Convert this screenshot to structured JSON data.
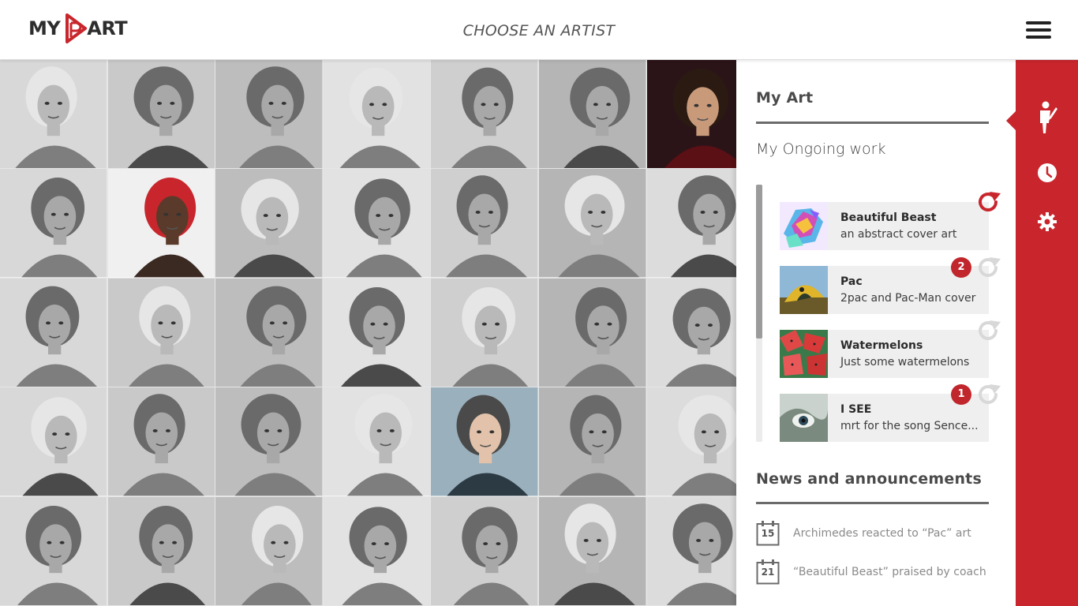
{
  "app": {
    "logo_left": "MY",
    "logo_right": "ART",
    "page_title": "CHOOSE AN ARTIST"
  },
  "artist_grid": {
    "rows": 5,
    "columns": 7,
    "highlighted_tiles": [
      6,
      8,
      25
    ]
  },
  "my_art": {
    "heading": "My Art",
    "subheading": "My Ongoing work",
    "items": [
      {
        "title": "Beautiful Beast",
        "description": "an abstract cover art",
        "badge": null,
        "refresh_active": true
      },
      {
        "title": "Pac",
        "description": "2pac and Pac-Man cover",
        "badge": "2",
        "refresh_active": false
      },
      {
        "title": "Watermelons",
        "description": "Just some watermelons",
        "badge": null,
        "refresh_active": false
      },
      {
        "title": "I SEE",
        "description": "mrt for the song Sence...",
        "badge": "1",
        "refresh_active": false
      }
    ]
  },
  "news": {
    "heading": "News and announcements",
    "items": [
      {
        "day": "15",
        "text": "Archimedes reacted to “Pac” art"
      },
      {
        "day": "21",
        "text": "“Beautiful Beast” praised by coach"
      }
    ]
  },
  "sidebar": {
    "items": [
      {
        "icon": "artist-icon",
        "active": true
      },
      {
        "icon": "clock-icon",
        "active": false
      },
      {
        "icon": "gear-icon",
        "active": false
      }
    ]
  },
  "colors": {
    "accent": "#c8262c",
    "badge": "#c0262c",
    "panel_bg": "#ffffff",
    "card_bg": "#efefef"
  }
}
